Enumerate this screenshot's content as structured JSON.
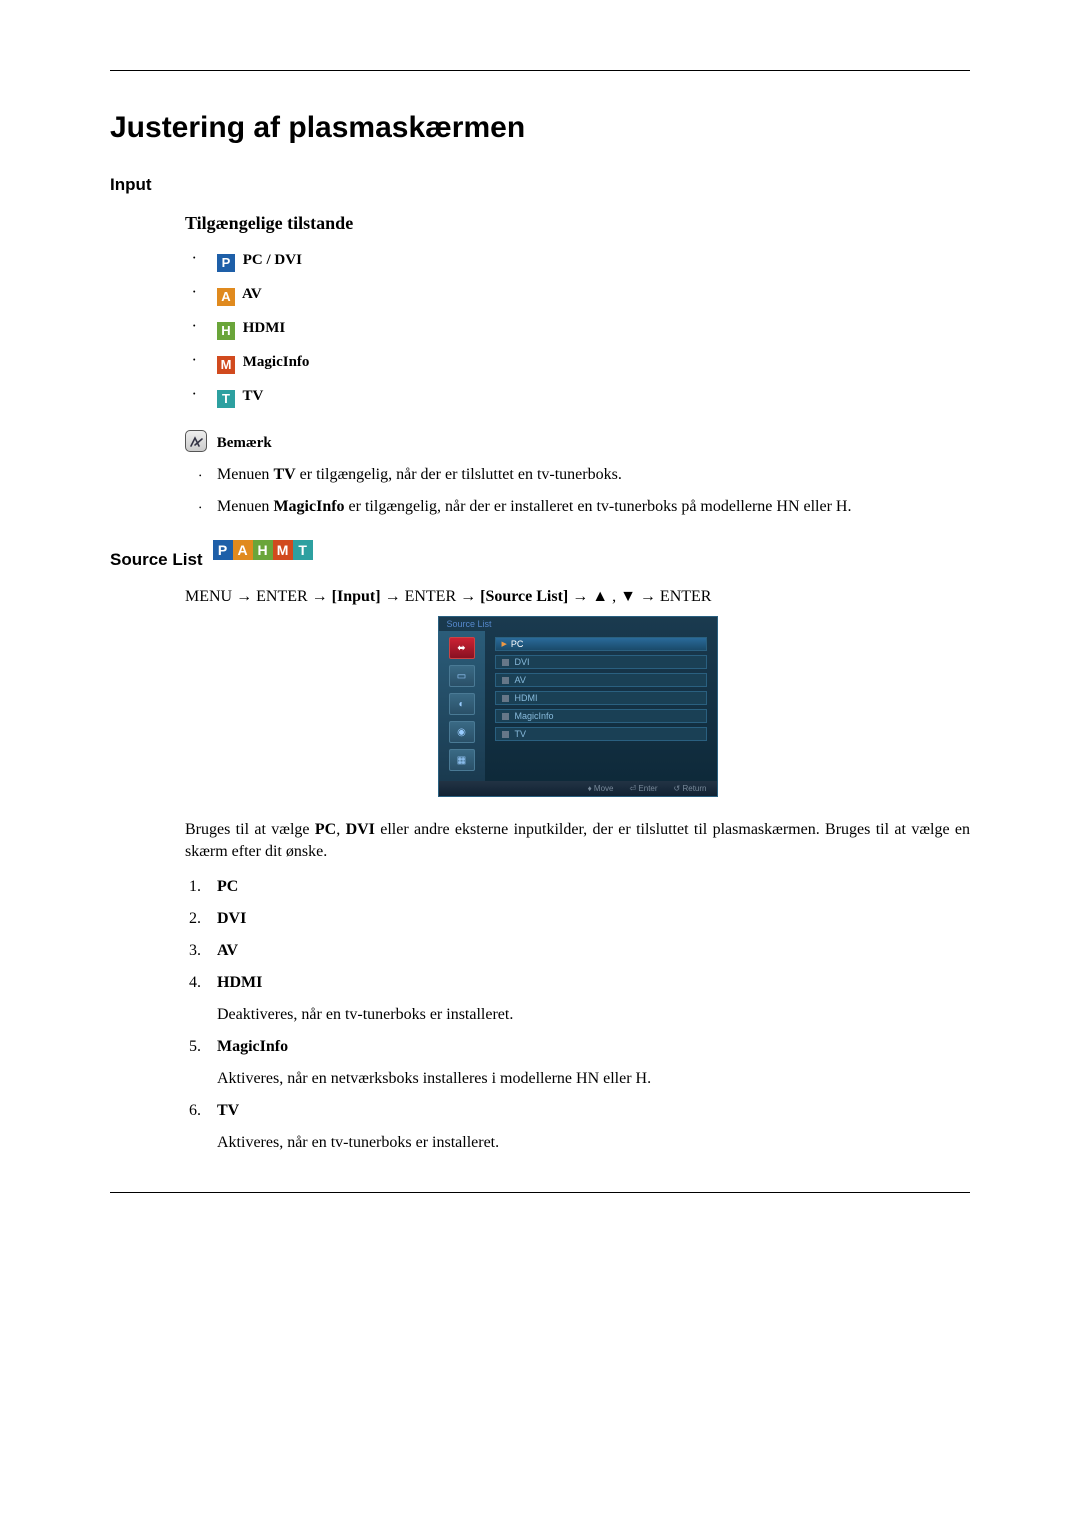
{
  "title": "Justering af plasmaskærmen",
  "section_input": "Input",
  "modes_heading": "Tilgængelige tilstande",
  "modes": {
    "pc_dvi": "PC / DVI",
    "av": "AV",
    "hdmi": "HDMI",
    "magicinfo": "MagicInfo",
    "tv": "TV"
  },
  "note_label": "Bemærk",
  "note_items": {
    "tv_pre": "Menuen ",
    "tv_bold": "TV",
    "tv_post": " er tilgængelig, når der er tilsluttet en tv-tunerboks.",
    "mi_pre": "Menuen ",
    "mi_bold": "MagicInfo",
    "mi_post": " er tilgængelig, når der er installeret en tv-tunerboks på modellerne HN eller H."
  },
  "source_list_heading": "Source List",
  "menu_path": {
    "p1": "MENU → ENTER → ",
    "b1": "[Input]",
    "p2": " → ENTER → ",
    "b2": "[Source List]",
    "p3": " → ▲ , ▼ → ENTER"
  },
  "osd": {
    "title": "Source List",
    "items": [
      "PC",
      "DVI",
      "AV",
      "HDMI",
      "MagicInfo",
      "TV"
    ],
    "footer": {
      "move": "Move",
      "enter": "Enter",
      "return": "Return"
    }
  },
  "body_para": {
    "pre": "Bruges til at vælge ",
    "b1": "PC",
    "mid1": ", ",
    "b2": "DVI",
    "post": " eller andre eksterne inputkilder, der er tilsluttet til plasmaskærmen. Bruges til at vælge en skærm efter dit ønske."
  },
  "numbered": [
    {
      "label": "PC"
    },
    {
      "label": "DVI"
    },
    {
      "label": "AV"
    },
    {
      "label": "HDMI",
      "desc": "Deaktiveres, når en tv-tunerboks er installeret."
    },
    {
      "label": "MagicInfo",
      "desc": "Aktiveres, når en netværksboks installeres i modellerne HN eller H."
    },
    {
      "label": "TV",
      "desc": "Aktiveres, når en tv-tunerboks er installeret."
    }
  ]
}
